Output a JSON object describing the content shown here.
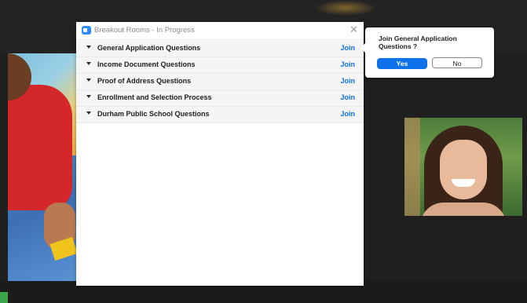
{
  "window": {
    "title": "Breakout Rooms - In Progress",
    "icon": "zoom-app-icon",
    "close_icon": "close-icon",
    "close_glyph": "✕"
  },
  "rooms": [
    {
      "name": "General Application Questions",
      "action": "Join"
    },
    {
      "name": "Income Document Questions",
      "action": "Join"
    },
    {
      "name": "Proof of Address Questions",
      "action": "Join"
    },
    {
      "name": "Enrollment and Selection Process",
      "action": "Join"
    },
    {
      "name": "Durham Public School Questions",
      "action": "Join"
    }
  ],
  "popover": {
    "question": "Join General Application Questions ?",
    "yes_label": "Yes",
    "no_label": "No"
  },
  "colors": {
    "accent": "#0e71eb",
    "background": "#1f1f1f",
    "row_background": "#f5f5f6"
  }
}
